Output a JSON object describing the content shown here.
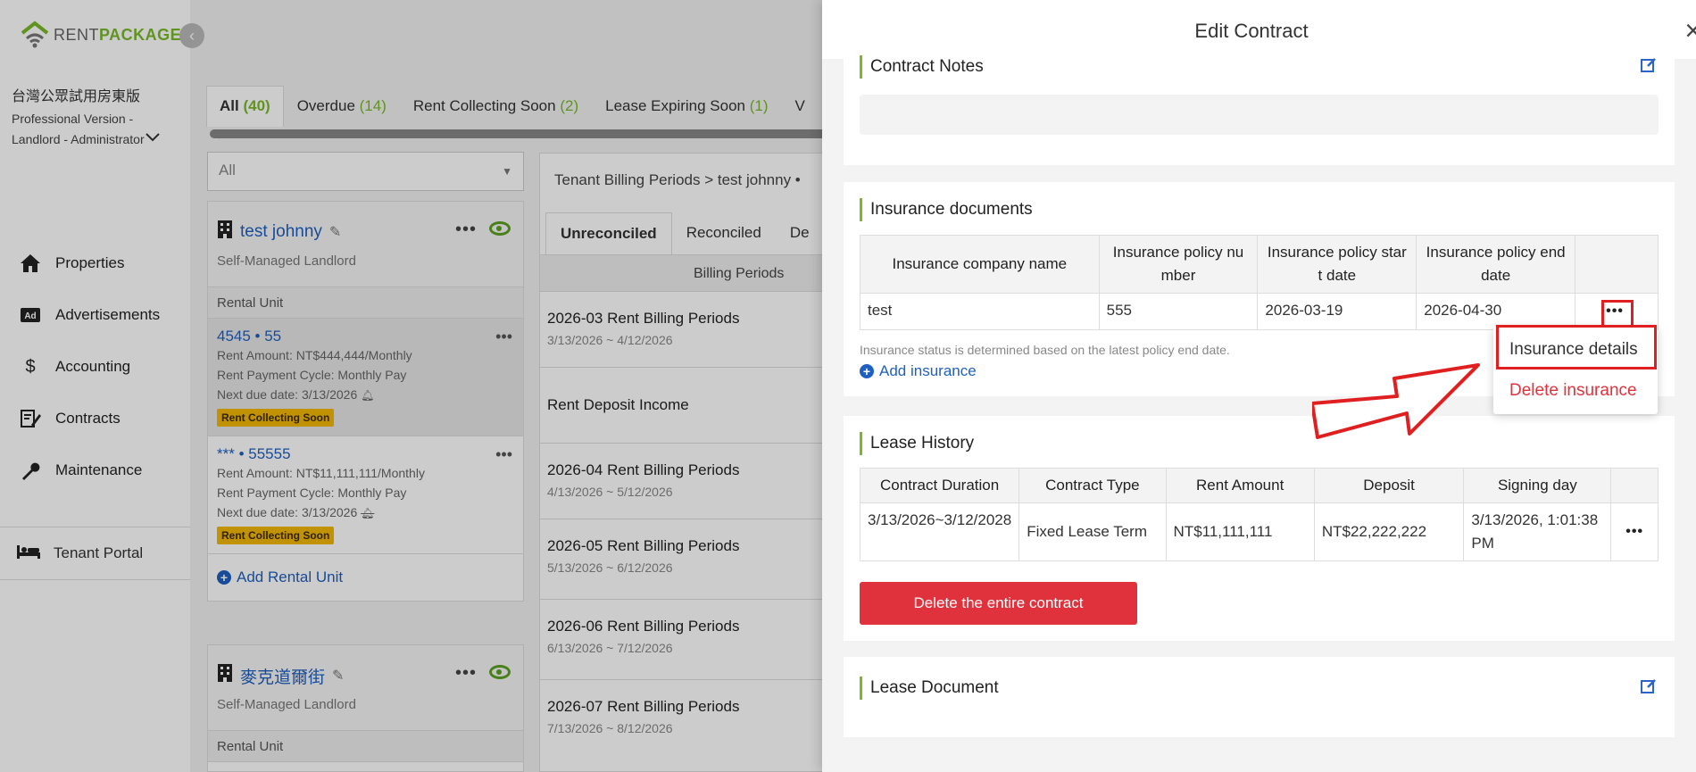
{
  "brand": {
    "rent": "RENT",
    "package": "PACKAGE"
  },
  "org": {
    "name": "台灣公眾試用房東版",
    "version": "Professional Version - Landlord - Administrator"
  },
  "nav": {
    "properties": "Properties",
    "advertisements": "Advertisements",
    "accounting": "Accounting",
    "contracts": "Contracts",
    "maintenance": "Maintenance",
    "tenant_portal": "Tenant Portal"
  },
  "filter_tabs": [
    {
      "label": "All",
      "count": "(40)"
    },
    {
      "label": "Overdue",
      "count": "(14)"
    },
    {
      "label": "Rent Collecting Soon",
      "count": "(2)"
    },
    {
      "label": "Lease Expiring Soon",
      "count": "(1)"
    },
    {
      "label": "V",
      "count": ""
    }
  ],
  "filter_select": {
    "value": "All"
  },
  "properties": [
    {
      "name": "test johnny",
      "type": "Self-Managed Landlord",
      "rental_unit_label": "Rental Unit",
      "units": [
        {
          "title": "4545 • 55",
          "rent": "Rent Amount: NT$444,444/Monthly",
          "cycle": "Rent Payment Cycle: Monthly Pay",
          "due": "Next due date:  3/13/2026",
          "badge": "Rent Collecting Soon"
        },
        {
          "title": "*** • 55555",
          "rent": "Rent Amount: NT$11,111,111/Monthly",
          "cycle": "Rent Payment Cycle: Monthly Pay",
          "due": "Next due date:  3/13/2026",
          "badge": "Rent Collecting Soon"
        }
      ],
      "add_unit": "Add Rental Unit"
    },
    {
      "name": "麥克道爾街",
      "type": "Self-Managed Landlord",
      "rental_unit_label": "Rental Unit"
    }
  ],
  "billing": {
    "breadcrumb": "Tenant Billing Periods >  test johnny •",
    "tabs": [
      "Unreconciled",
      "Reconciled",
      "De"
    ],
    "column": "Billing Periods",
    "rows": [
      {
        "title": "2026-03 Rent Billing Periods",
        "date": "3/13/2026 ~ 4/12/2026"
      },
      {
        "title": "Rent Deposit Income",
        "date": ""
      },
      {
        "title": "2026-04 Rent Billing Periods",
        "date": "4/13/2026 ~ 5/12/2026"
      },
      {
        "title": "2026-05 Rent Billing Periods",
        "date": "5/13/2026 ~ 6/12/2026"
      },
      {
        "title": "2026-06 Rent Billing Periods",
        "date": "6/13/2026 ~ 7/12/2026"
      },
      {
        "title": "2026-07 Rent Billing Periods",
        "date": "7/13/2026 ~ 8/12/2026"
      }
    ]
  },
  "drawer": {
    "title": "Edit Contract",
    "close": "×",
    "contract_notes": {
      "title": "Contract Notes"
    },
    "insurance": {
      "title": "Insurance documents",
      "headers": [
        "Insurance company name",
        "Insurance policy nu mber",
        "Insurance policy star t date",
        "Insurance policy end date",
        ""
      ],
      "rows": [
        {
          "company": "test",
          "number": "555",
          "start": "2026-03-19",
          "end": "2026-04-30"
        }
      ],
      "note": "Insurance status is determined based on the latest policy end date.",
      "add": "Add insurance",
      "menu": {
        "details": "Insurance details",
        "delete": "Delete insurance"
      }
    },
    "lease_history": {
      "title": "Lease History",
      "headers": [
        "Contract Duration",
        "Contract Type",
        "Rent Amount",
        "Deposit",
        "Signing day",
        ""
      ],
      "rows": [
        {
          "duration": "3/13/2026~3/12/2028",
          "type": "Fixed Lease Term",
          "rent": "NT$11,111,111",
          "deposit": "NT$22,222,222",
          "signing": "3/13/2026, 1:01:38 PM"
        }
      ],
      "delete": "Delete the entire contract"
    },
    "lease_document": {
      "title": "Lease Document"
    }
  },
  "colors": {
    "accent": "#79b928",
    "link": "#1f5fbf",
    "danger": "#e0323c",
    "highlight": "#e02020",
    "badge": "#f2b705"
  }
}
